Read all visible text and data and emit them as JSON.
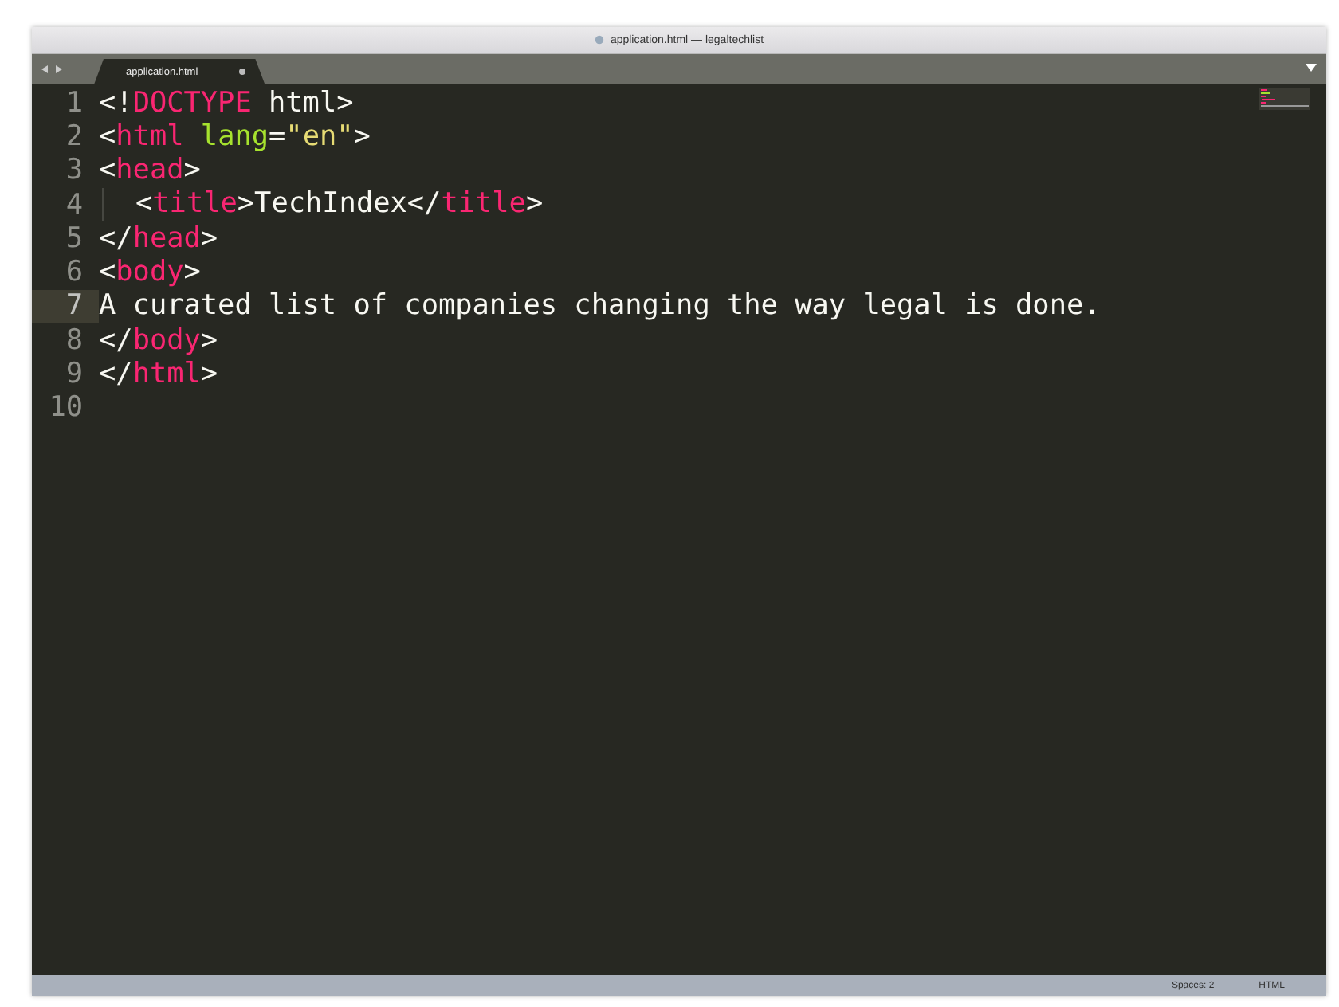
{
  "window": {
    "title": "application.html — legaltechlist"
  },
  "tabs": [
    {
      "label": "application.html",
      "selected": true,
      "modified": true
    }
  ],
  "editor": {
    "lines": [
      {
        "number": "1",
        "current": false,
        "tokens": [
          {
            "kind": "punct",
            "text": "<!"
          },
          {
            "kind": "tag",
            "text": "DOCTYPE"
          },
          {
            "kind": "text",
            "text": " html>"
          }
        ]
      },
      {
        "number": "2",
        "current": false,
        "tokens": [
          {
            "kind": "punct",
            "text": "<"
          },
          {
            "kind": "tag",
            "text": "html"
          },
          {
            "kind": "attr",
            "text": " lang"
          },
          {
            "kind": "punct",
            "text": "="
          },
          {
            "kind": "string",
            "text": "\"en\""
          },
          {
            "kind": "punct",
            "text": ">"
          }
        ]
      },
      {
        "number": "3",
        "current": false,
        "tokens": [
          {
            "kind": "punct",
            "text": "<"
          },
          {
            "kind": "tag",
            "text": "head"
          },
          {
            "kind": "punct",
            "text": ">"
          }
        ]
      },
      {
        "number": "4",
        "current": false,
        "indent": true,
        "tokens": [
          {
            "kind": "punct",
            "text": "<"
          },
          {
            "kind": "tag",
            "text": "title"
          },
          {
            "kind": "punct",
            "text": ">TechIndex</"
          },
          {
            "kind": "tag",
            "text": "title"
          },
          {
            "kind": "punct",
            "text": ">"
          }
        ]
      },
      {
        "number": "5",
        "current": false,
        "tokens": [
          {
            "kind": "punct",
            "text": "</"
          },
          {
            "kind": "tag",
            "text": "head"
          },
          {
            "kind": "punct",
            "text": ">"
          }
        ]
      },
      {
        "number": "6",
        "current": false,
        "tokens": [
          {
            "kind": "punct",
            "text": "<"
          },
          {
            "kind": "tag",
            "text": "body"
          },
          {
            "kind": "punct",
            "text": ">"
          }
        ]
      },
      {
        "number": "7",
        "current": true,
        "tokens": [
          {
            "kind": "text",
            "text": "A curated list of companies changing the way legal is done."
          }
        ]
      },
      {
        "number": "8",
        "current": false,
        "tokens": [
          {
            "kind": "punct",
            "text": "</"
          },
          {
            "kind": "tag",
            "text": "body"
          },
          {
            "kind": "punct",
            "text": ">"
          }
        ]
      },
      {
        "number": "9",
        "current": false,
        "tokens": [
          {
            "kind": "punct",
            "text": "</"
          },
          {
            "kind": "tag",
            "text": "html"
          },
          {
            "kind": "punct",
            "text": ">"
          }
        ]
      },
      {
        "number": "10",
        "current": false
      }
    ]
  },
  "status_bar": {
    "indentation": "Spaces: 2",
    "syntax": "HTML"
  }
}
